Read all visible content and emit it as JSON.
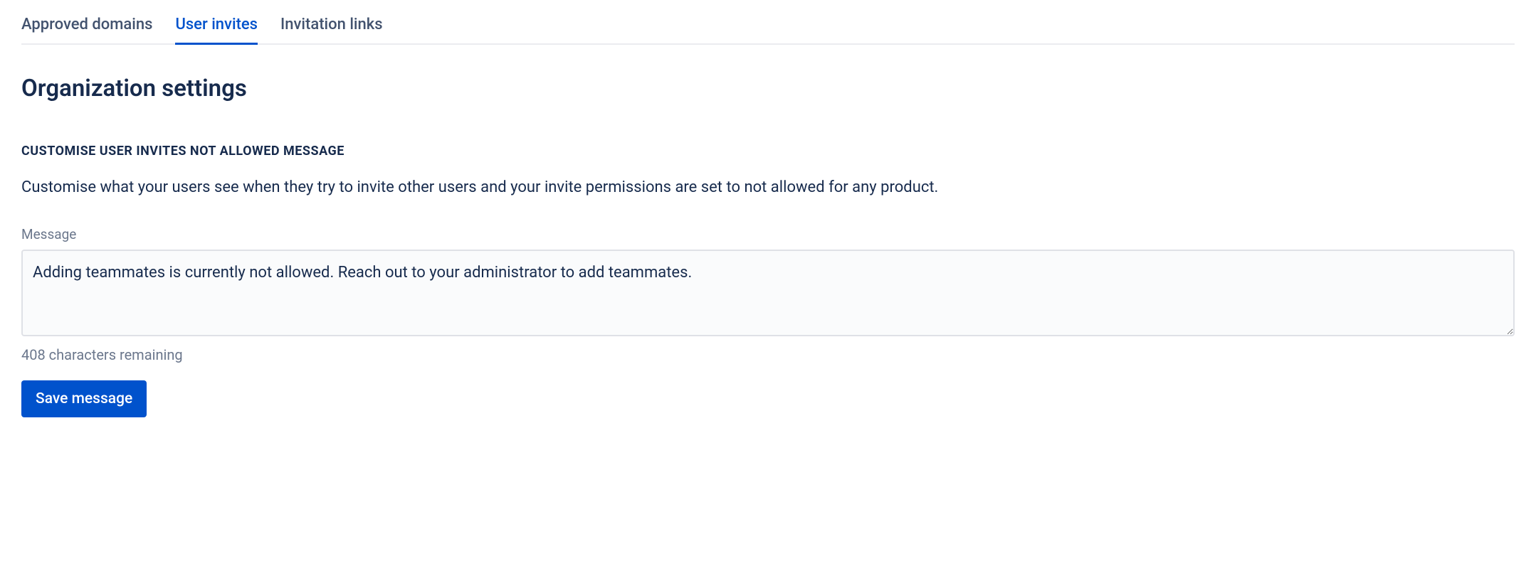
{
  "tabs": {
    "approved_domains": "Approved domains",
    "user_invites": "User invites",
    "invitation_links": "Invitation links"
  },
  "page": {
    "title": "Organization settings"
  },
  "section": {
    "header": "CUSTOMISE USER INVITES NOT ALLOWED MESSAGE",
    "description": "Customise what your users see when they try to invite other users and your invite permissions are set to not allowed for any product."
  },
  "form": {
    "message_label": "Message",
    "message_value": "Adding teammates is currently not allowed. Reach out to your administrator to add teammates.",
    "chars_remaining": "408 characters remaining",
    "save_label": "Save message"
  }
}
